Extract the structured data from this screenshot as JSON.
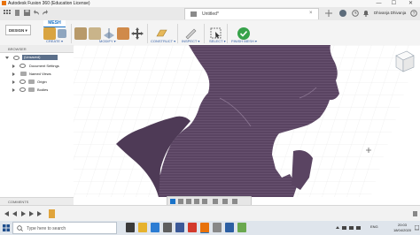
{
  "window": {
    "title": "Autodesk Fusion 360 (Education License)",
    "minimize": "—",
    "maximize": "☐",
    "close": "✕"
  },
  "header": {
    "doc_title": "Untitled*",
    "user": "Dhivanja Dhivanja"
  },
  "toolbar": {
    "active_tab": "MESH",
    "workspace": "DESIGN ▾",
    "groups": {
      "create": "CREATE ▾",
      "modify": "MODIFY ▾",
      "construct": "CONSTRUCT ▾",
      "inspect": "INSPECT ▾",
      "select": "SELECT ▾",
      "finish": "FINISH MESH ▾"
    }
  },
  "browser": {
    "title": "BROWSER",
    "root": "(Unsaved)",
    "items": [
      "Document Settings",
      "Named Views",
      "Origin",
      "Bodies"
    ]
  },
  "comments": {
    "title": "COMMENTS"
  },
  "taskbar": {
    "search_placeholder": "Type here to search",
    "lang": "ENG",
    "time": "20:03",
    "date": "18/04/2020"
  },
  "colors": {
    "mesh": "#5a4462",
    "accent": "#1a73c9",
    "finish": "#37a24a"
  }
}
